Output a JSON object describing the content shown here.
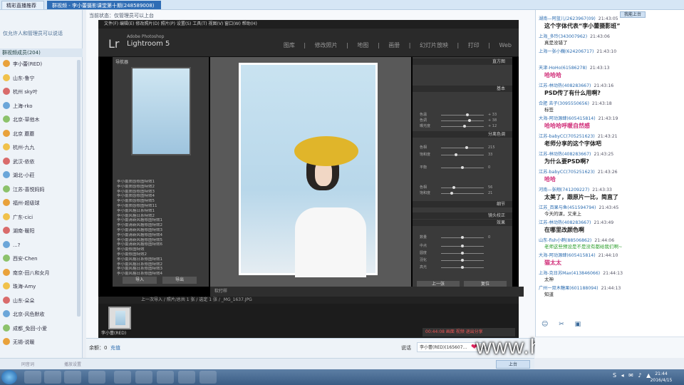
{
  "tabs": [
    {
      "label": "精彩直播推荐"
    },
    {
      "label": "群视频 - 李小蕾摄影课堂第十期(248589008)"
    }
  ],
  "left": {
    "info": "仅允许人和管理员可以说话",
    "members_header": "群视频成员(204)",
    "members": [
      "李小蕾(RED)",
      "山东-鲁宁",
      "杭州 sky叶",
      "上海-rko",
      "北京-草他木",
      "北京 蘑蘑",
      "杭州-九九",
      "武汉-依依",
      "湖北-小莊",
      "江苏-喜悦妈妈",
      "福州-超级球",
      "广东-cici",
      "湖南-暖阳",
      "...?",
      "西安-Chen",
      "南京-田八和女月",
      "珠海-Amy",
      "山东-朵朵",
      "北京-风色默收",
      "成都_免回-小爱",
      "无锡-说暖"
    ]
  },
  "screen": {
    "status": "当前状态：仅管理员可以上台",
    "lr_menu": "文件(F)  编辑(E)  修改照片(D)  照片(P)  设置(S)  工具(T)  视图(V)  窗口(W)  帮助(H)",
    "lr_title": "1 - Adobe Photoshop Lightroom - 修改照片",
    "lr_logo": "Lr",
    "lr_sub": "Adobe Photoshop",
    "lr_name": "Lightroom 5",
    "lr_modules": "图库 | 修改照片 | 地图 | 画册 | 幻灯片放映 | 打印 | Web",
    "nav_title": "导航器",
    "presets": [
      "李小蕾质感修图特效1",
      "李小蕾质感修图特效2",
      "李小蕾质感修图特效3",
      "李小蕾质感修图特效4",
      "李小蕾质感修图特效5",
      "李小蕾质感修图特效11",
      "李小蕾风格日系特效1",
      "李小蕾风格日系特效2",
      "李小蕾清新风格修图特效1",
      "李小蕾清新风格修图特效2",
      "李小蕾清新风格修图特效3",
      "李小蕾清新风格修图特效4",
      "李小蕾清新风格修图特效5",
      "李小蕾清新风格修图特效6",
      "李小蕾修图特效",
      "李小蕾修图特效2",
      "李小蕾风格日系修图特效1",
      "李小蕾风格日系修图特效2",
      "李小蕾风格日系修图特效3",
      "李小蕾风格日系修图特效4"
    ],
    "right_heads": [
      "直方图",
      "基本",
      "分离色调",
      "细节",
      "镜头校正",
      "效果"
    ],
    "sliders": [
      {
        "label": "色温",
        "value": "+ 33",
        "pos": 0.62
      },
      {
        "label": "色调",
        "value": "+ 38",
        "pos": 0.66
      },
      {
        "label": "曝光度",
        "value": "+ 12",
        "pos": 0.55
      },
      {
        "label": "色相",
        "value": "215",
        "pos": 0.6
      },
      {
        "label": "饱和度",
        "value": "33",
        "pos": 0.35
      },
      {
        "label": "平衡",
        "value": "0",
        "pos": 0.5
      },
      {
        "label": "色相",
        "value": "56",
        "pos": 0.3
      },
      {
        "label": "饱和度",
        "value": "21",
        "pos": 0.25
      },
      {
        "label": "数量",
        "value": "0",
        "pos": 0.5
      },
      {
        "label": "中点",
        "value": "",
        "pos": 0.5
      },
      {
        "label": "圆度",
        "value": "",
        "pos": 0.5
      },
      {
        "label": "羽化",
        "value": "",
        "pos": 0.5
      },
      {
        "label": "高光",
        "value": "",
        "pos": 0.5
      }
    ],
    "btn_prev": "上一张",
    "btn_reset": "复位",
    "toolbar": "上一次导入  /  照片/总共 1 张 /  选定 1 张 / _MG_1637.JPG",
    "filmbar": "_MG_1637.JPG",
    "nick": "李小蕾(RED)",
    "rec": "00:44:08  画面  视频  退出分享",
    "lr_btn_import": "导入",
    "lr_btn_export": "导出",
    "soft_proof": "软打样"
  },
  "bottom": {
    "balance": "余额：0",
    "balance_link": "充值",
    "speaker_label": "说话",
    "speaker": "李小蕾(RED)(165607...",
    "heart": "❤",
    "heart_count": "x1",
    "watermark": "www.hunls.com",
    "left_ph": "同音词",
    "left_ph2": "播放设置",
    "upmic": "上台"
  },
  "chat": {
    "top_btn": "我能上台",
    "messages": [
      {
        "name": "湖南—阿蓝儿(2623967(09)",
        "time": "21:43:05",
        "text": "这个字体代表“李小蕾摄影班”",
        "big": true
      },
      {
        "name": "上海_多玲(343007962)",
        "time": "21:43:06",
        "text": "真是没错了",
        "big": false
      },
      {
        "name": "上海一张小巍(624206717)",
        "time": "21:43:10",
        "text": "",
        "big": false
      },
      {
        "name": "天津-HoHo(61586278)",
        "time": "21:43:13",
        "text": "哈哈哈",
        "big": true
      },
      {
        "name": "江苏-林动热(408283667)",
        "time": "21:43:16",
        "text": "PSD传了有什么用啊?",
        "big": true
      },
      {
        "name": "合肥 去子(3095550656)",
        "time": "21:43:18",
        "text": "标签",
        "big": false
      },
      {
        "name": "大海-阿动源肆(605415814)",
        "time": "21:43:19",
        "text": "哈哈哈呼暖自然感",
        "big": true
      },
      {
        "name": "江苏-babyCC(705251623)",
        "time": "21:43:21",
        "text": "老师分享的这个字体吧",
        "big": true
      },
      {
        "name": "江苏-林动热(408283667)",
        "time": "21:43:25",
        "text": "为什么要PSD啊?",
        "big": true
      },
      {
        "name": "江苏-babyCC(705251623)",
        "time": "21:43:26",
        "text": "哈哈",
        "big": true
      },
      {
        "name": "河南—张翔(741209227)",
        "time": "21:43:33",
        "text": "太美了，跟原片一比，简直了",
        "big": true
      },
      {
        "name": "江苏_百果与鱼(451594794)",
        "time": "21:43:45",
        "text": "今天的课，又来上",
        "big": false
      },
      {
        "name": "江苏-林动热(408283667)",
        "time": "21:43:49",
        "text": "在哪里改颜色啊",
        "big": true
      },
      {
        "name": "山东-fish小鹤(88506862)",
        "time": "21:44:06",
        "text": "老师这些预设是不是没有都给我们啊~",
        "big": false
      },
      {
        "name": "大海-阿动源肆(605415814)",
        "time": "21:44:10",
        "text": "猫太太",
        "big": true
      },
      {
        "name": "上海-克日苏Max(413846066)",
        "time": "21:44:13",
        "text": "太神",
        "big": false
      },
      {
        "name": "广州一双木糖果(601188094)",
        "time": "21:44:13",
        "text": "知道",
        "big": false
      }
    ],
    "tools": "☺ ✂ ▣"
  },
  "taskbar": {
    "time": "21:44",
    "date": "2016/4/15",
    "tray": "S ◂ ✉ ♪ ▲"
  },
  "colors": {
    "accent": "#2f6db5",
    "chat_name": "#2b6cb0",
    "chat_text_big": "#000000",
    "chat_pink": "#d1307a",
    "chat_green": "#2a9d2a"
  }
}
